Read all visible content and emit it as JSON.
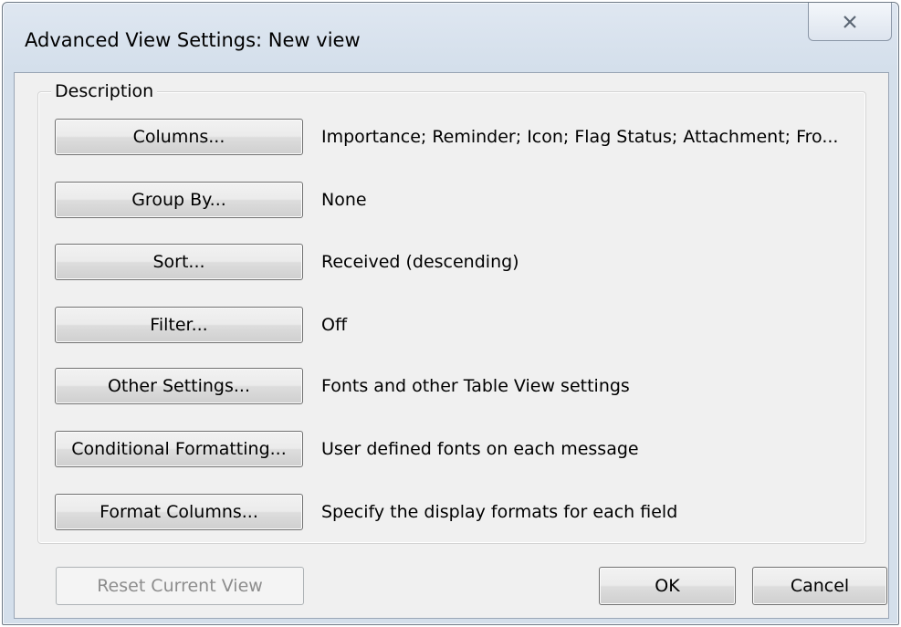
{
  "window": {
    "title": "Advanced View Settings: New view",
    "close_icon": "close-icon"
  },
  "description": {
    "legend": "Description",
    "rows": [
      {
        "button": "Columns...",
        "value": "Importance; Reminder; Icon; Flag Status; Attachment; Fro..."
      },
      {
        "button": "Group By...",
        "value": "None"
      },
      {
        "button": "Sort...",
        "value": "Received (descending)"
      },
      {
        "button": "Filter...",
        "value": "Off"
      },
      {
        "button": "Other Settings...",
        "value": "Fonts and other Table View settings"
      },
      {
        "button": "Conditional Formatting...",
        "value": "User defined fonts on each message"
      },
      {
        "button": "Format Columns...",
        "value": "Specify the display formats for each field"
      }
    ]
  },
  "footer": {
    "reset_label": "Reset Current View",
    "ok_label": "OK",
    "cancel_label": "Cancel"
  }
}
